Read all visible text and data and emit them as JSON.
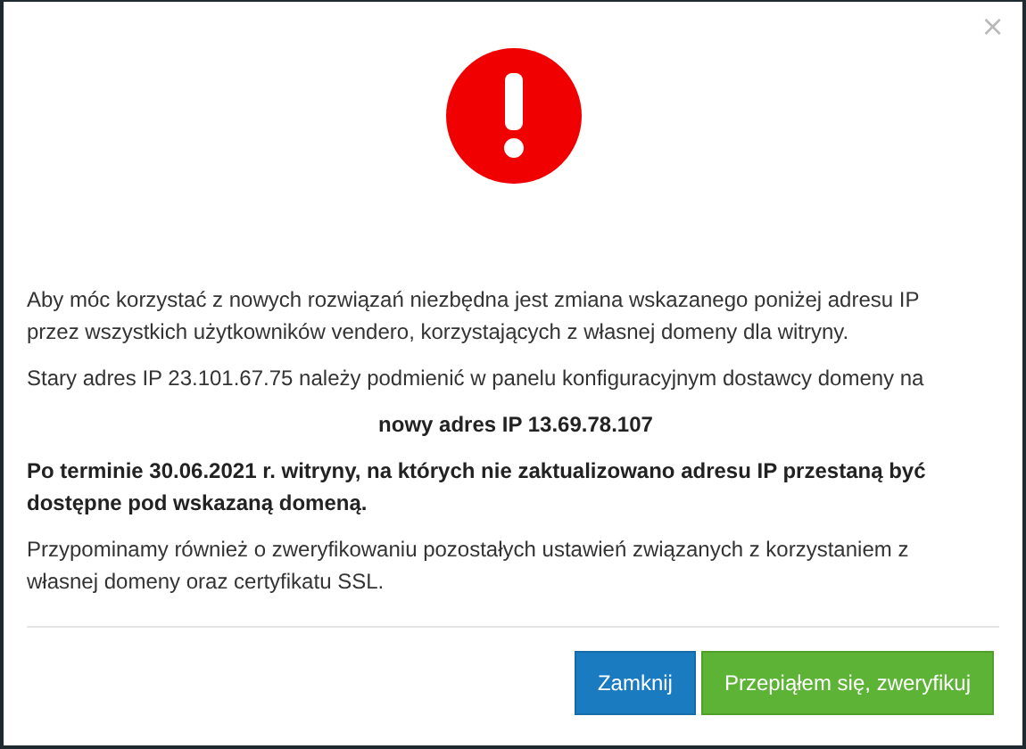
{
  "dialog": {
    "close": "×",
    "paragraphs": [
      {
        "kind": "normal",
        "text": "Aby móc korzystać z nowych rozwiązań niezbędna jest zmiana wskazanego poniżej adresu IP przez wszystkich użytkowników vendero, korzystających z własnej domeny dla witryny."
      },
      {
        "kind": "normal",
        "text": "Stary adres IP 23.101.67.75 należy podmienić w panelu konfiguracyjnym dostawcy domeny na"
      },
      {
        "kind": "center-bold",
        "text": "nowy adres IP 13.69.78.107"
      },
      {
        "kind": "bold",
        "text": "Po terminie 30.06.2021 r. witryny, na których nie zaktualizowano adresu IP przestaną być dostępne pod wskazaną domeną."
      },
      {
        "kind": "normal",
        "text": "Przypominamy również o zweryfikowaniu pozostałych ustawień związanych z korzystaniem z własnej domeny oraz certyfikatu SSL."
      }
    ],
    "buttons": [
      {
        "kind": "primary",
        "label": "Zamknij"
      },
      {
        "kind": "success",
        "label": "Przepiąłem się, zweryfikuj"
      }
    ]
  }
}
